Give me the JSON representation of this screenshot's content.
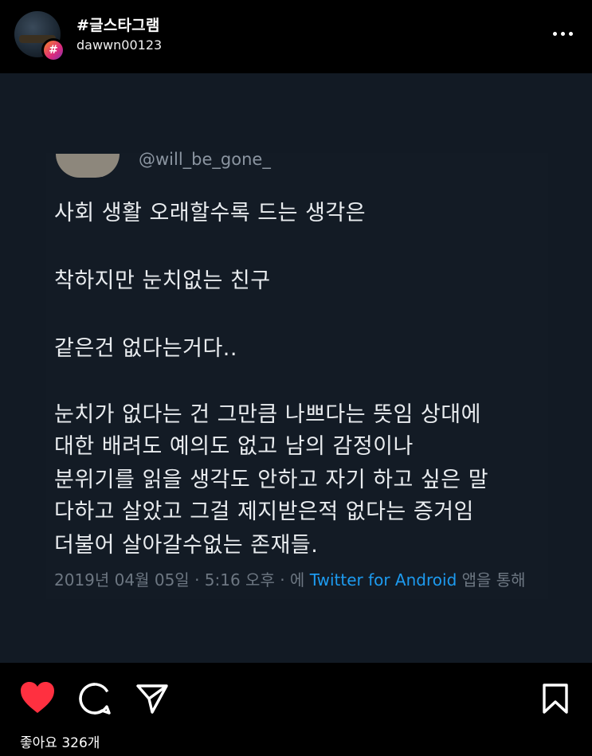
{
  "header": {
    "title": "#글스타그램",
    "username": "dawwn00123",
    "badge_symbol": "#"
  },
  "tweet": {
    "handle": "@will_be_gone_",
    "lines": [
      "사회 생활 오래할수록 드는 생각은",
      "착하지만 눈치없는 친구",
      "같은건 없다는거다..",
      "눈치가 없다는 건 그만큼 나쁘다는 뜻임 상대에",
      "대한 배려도 예의도 없고 남의 감정이나",
      "분위기를 읽을 생각도 안하고 자기 하고 싶은 말",
      "다하고 살았고 그걸 제지받은적 없다는 증거임",
      "더불어 살아갈수없는 존재들."
    ],
    "meta_prefix": "2019년 04월 05일 · 5:16 오후 · 에 ",
    "meta_link": "Twitter for Android",
    "meta_suffix": " 앱을 통해"
  },
  "actions": {
    "like_icon": "heart-icon",
    "comment_icon": "comment-icon",
    "share_icon": "send-icon",
    "save_icon": "bookmark-icon",
    "like_color": "#ff3040"
  },
  "likes_text": "좋아요 326개"
}
